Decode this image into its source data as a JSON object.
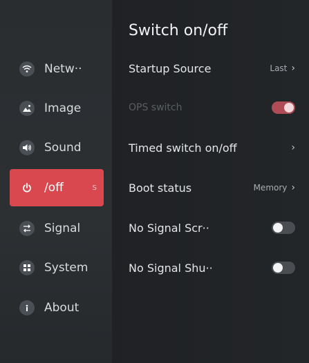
{
  "sidebar": {
    "items": [
      {
        "label": "Netw··",
        "icon": "wifi-icon"
      },
      {
        "label": "Image",
        "icon": "image-icon"
      },
      {
        "label": "Sound",
        "icon": "speaker-icon"
      },
      {
        "label": "∕off",
        "icon": "power-icon",
        "badge": "S",
        "active": true
      },
      {
        "label": "Signal",
        "icon": "input-source-icon"
      },
      {
        "label": "System",
        "icon": "grid-icon"
      },
      {
        "label": "About",
        "icon": "info-icon"
      }
    ]
  },
  "main": {
    "title": "Switch on/off",
    "rows": [
      {
        "label": "Startup Source",
        "value": "Last",
        "type": "link"
      },
      {
        "label": "OPS switch",
        "type": "toggle",
        "state": "on",
        "disabled": true
      },
      {
        "label": "Timed switch on/off",
        "value": "",
        "type": "link"
      },
      {
        "label": "Boot status",
        "value": "Memory",
        "type": "link"
      },
      {
        "label": "No Signal Scr··",
        "type": "toggle",
        "state": "off"
      },
      {
        "label": "No Signal Shu··",
        "type": "toggle",
        "state": "off"
      }
    ]
  },
  "colors": {
    "accent": "#d9474f",
    "background": "#1f2124",
    "sidebar": "#2c3033"
  }
}
